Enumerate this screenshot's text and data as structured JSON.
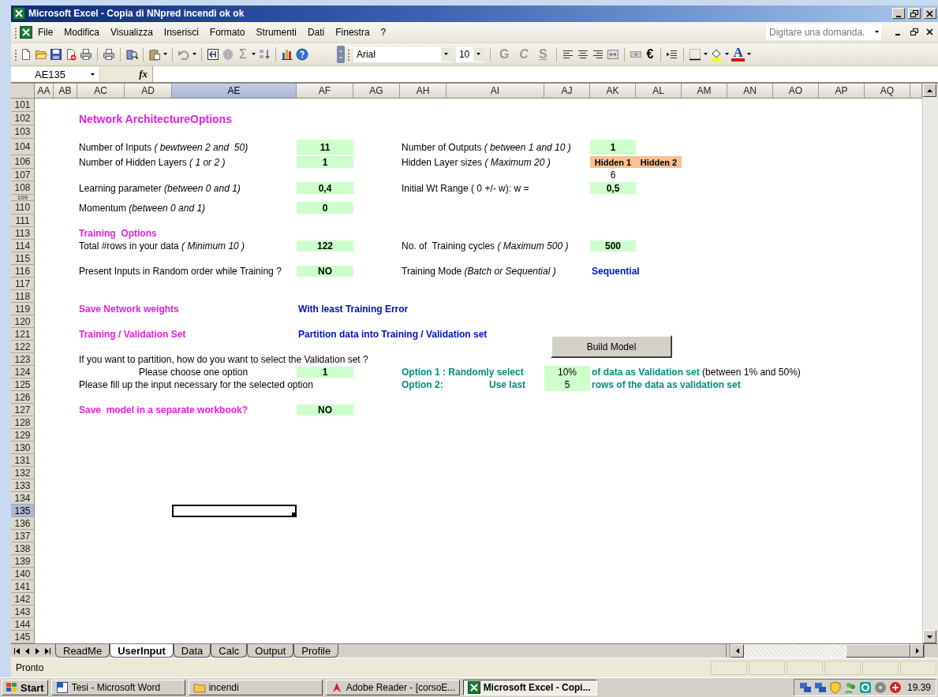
{
  "window": {
    "title": "Microsoft Excel - Copia di NNpred incendi ok ok"
  },
  "menu": {
    "items": [
      "File",
      "Modifica",
      "Visualizza",
      "Inserisci",
      "Formato",
      "Strumenti",
      "Dati",
      "Finestra",
      "?"
    ],
    "help_box": {
      "placeholder": "Digitare una domanda."
    }
  },
  "toolbar": {
    "sum": "Σ",
    "font": "Arial",
    "font_size": "10",
    "format_buttons": [
      "G",
      "C",
      "S"
    ],
    "currency": "€",
    "font_color": "A"
  },
  "formula_bar": {
    "name_box": "AE135",
    "fx": "fx"
  },
  "columns": [
    {
      "label": "AA",
      "selected": false
    },
    {
      "label": "AB",
      "selected": false
    },
    {
      "label": "AC",
      "selected": false
    },
    {
      "label": "AD",
      "selected": false
    },
    {
      "label": "AE",
      "selected": true
    },
    {
      "label": "AF",
      "selected": false
    },
    {
      "label": "AG",
      "selected": false
    },
    {
      "label": "AH",
      "selected": false
    },
    {
      "label": "AI",
      "selected": false
    },
    {
      "label": "AJ",
      "selected": false
    },
    {
      "label": "AK",
      "selected": false
    },
    {
      "label": "AL",
      "selected": false
    },
    {
      "label": "AM",
      "selected": false
    },
    {
      "label": "AN",
      "selected": false
    },
    {
      "label": "AO",
      "selected": false
    },
    {
      "label": "AP",
      "selected": false
    },
    {
      "label": "AQ",
      "selected": false
    }
  ],
  "rows": [
    {
      "label": "101",
      "kind": "tall",
      "selected": false
    },
    {
      "label": "102",
      "kind": "tall",
      "selected": false,
      "cells": {
        "ac": {
          "kind": "title",
          "text": "Network ArchitectureOptions"
        }
      }
    },
    {
      "label": "103",
      "kind": "tall",
      "selected": false
    },
    {
      "label": "104",
      "kind": "taller",
      "selected": false,
      "cells": {
        "ac": {
          "kind": "label",
          "text": "Number of Inputs *( bewtween 2 and  50)*"
        },
        "af": {
          "kind": "input",
          "text": "11"
        },
        "ah": {
          "kind": "label",
          "text": "Number of Outputs *( between 1 and 10 )*"
        },
        "ak": {
          "kind": "input",
          "text": "1"
        }
      }
    },
    {
      "label": "106",
      "kind": "tall",
      "selected": false,
      "cells": {
        "ac": {
          "kind": "label",
          "text": "Number of Hidden Layers *( 1 or 2 )*"
        },
        "af": {
          "kind": "input",
          "text": "1"
        },
        "ah": {
          "kind": "label",
          "text": "Hidden Layer sizes *( Maximum 20 )*"
        },
        "ak": {
          "kind": "layer-header",
          "text": "Hidden 1"
        },
        "al": {
          "kind": "layer-header",
          "text": "Hidden 2"
        }
      }
    },
    {
      "label": "107",
      "kind": "normal",
      "selected": false,
      "cells": {
        "ak": {
          "kind": "number",
          "text": "6"
        }
      }
    },
    {
      "label": "108",
      "kind": "tall",
      "selected": false,
      "cells": {
        "ac": {
          "kind": "label",
          "text": "Learning parameter *(between 0 and 1)*"
        },
        "af": {
          "kind": "input",
          "text": "0,4"
        },
        "ah": {
          "kind": "label",
          "text": "Initial Wt Range ( 0 +/- w): w ="
        },
        "ak": {
          "kind": "input",
          "text": "0,5"
        }
      }
    },
    {
      "label": "109",
      "kind": "short",
      "selected": false
    },
    {
      "label": "110",
      "kind": "tall",
      "selected": false,
      "cells": {
        "ac": {
          "kind": "label",
          "text": "Momentum *(between 0 and 1)*"
        },
        "af": {
          "kind": "input",
          "text": "0"
        }
      }
    },
    {
      "label": "111",
      "kind": "normal",
      "selected": false
    },
    {
      "label": "113",
      "kind": "normal",
      "selected": false,
      "cells": {
        "ac": {
          "kind": "heading",
          "text": "Training  Options"
        }
      }
    },
    {
      "label": "114",
      "kind": "normal",
      "selected": false,
      "cells": {
        "ac": {
          "kind": "label",
          "text": "Total #rows in your data *( Minimum 10 )*"
        },
        "af": {
          "kind": "input",
          "text": "122"
        },
        "ah": {
          "kind": "label",
          "text": "No. of  Training cycles *( Maximum 500 )*"
        },
        "ak": {
          "kind": "input",
          "text": "500"
        }
      }
    },
    {
      "label": "115",
      "kind": "normal",
      "selected": false
    },
    {
      "label": "116",
      "kind": "normal",
      "selected": false,
      "cells": {
        "ac": {
          "kind": "label",
          "text": "Present Inputs in Random order while Training ?"
        },
        "af": {
          "kind": "input",
          "text": "NO"
        },
        "ah": {
          "kind": "label",
          "text": "Training Mode *(Batch or Sequential )*"
        },
        "ak": {
          "kind": "value",
          "text": "Sequential"
        }
      }
    },
    {
      "label": "117",
      "kind": "normal",
      "selected": false
    },
    {
      "label": "118",
      "kind": "normal",
      "selected": false
    },
    {
      "label": "119",
      "kind": "normal",
      "selected": false,
      "cells": {
        "ac": {
          "kind": "heading",
          "text": "Save Network weights"
        },
        "af": {
          "kind": "value",
          "text": "With least Training Error"
        }
      }
    },
    {
      "label": "120",
      "kind": "normal",
      "selected": false
    },
    {
      "label": "121",
      "kind": "normal",
      "selected": false,
      "cells": {
        "ac": {
          "kind": "heading",
          "text": "Training / Validation Set"
        },
        "af": {
          "kind": "value",
          "text": "Partition data into Training / Validation set"
        }
      }
    },
    {
      "label": "122",
      "kind": "normal",
      "selected": false
    },
    {
      "label": "123",
      "kind": "normal",
      "selected": false,
      "cells": {
        "ac": {
          "kind": "label",
          "text": "If you want to partition, how do you want to select the Validation set ?"
        }
      }
    },
    {
      "label": "124",
      "kind": "normal",
      "selected": false,
      "cells": {
        "ad": {
          "kind": "indented",
          "text": "Please choose one option"
        },
        "af": {
          "kind": "input",
          "text": "1"
        },
        "ah": {
          "kind": "option",
          "text": "Option 1 : Randomly select"
        },
        "aj": {
          "kind": "input-plain",
          "text": "10%"
        },
        "ak": {
          "kind": "mixed",
          "text": "**of data as Validation set** (between 1% and 50%)"
        }
      }
    },
    {
      "label": "125",
      "kind": "normal",
      "selected": false,
      "cells": {
        "ac": {
          "kind": "label",
          "text": "Please fill up the input necessary for the selected option"
        },
        "ah": {
          "kind": "option",
          "text": "Option 2:"
        },
        "ai": {
          "kind": "option-right",
          "text": "Use last"
        },
        "aj": {
          "kind": "input-plain",
          "text": "5"
        },
        "ak": {
          "kind": "option",
          "text": "rows of the data as validation set"
        }
      }
    },
    {
      "label": "126",
      "kind": "normal",
      "selected": false
    },
    {
      "label": "127",
      "kind": "normal",
      "selected": false,
      "cells": {
        "ac": {
          "kind": "heading",
          "text": "Save  model in a separate workbook?"
        },
        "af": {
          "kind": "input",
          "text": "NO"
        }
      }
    },
    {
      "label": "128",
      "kind": "normal",
      "selected": false
    },
    {
      "label": "129",
      "kind": "normal",
      "selected": false
    },
    {
      "label": "130",
      "kind": "normal",
      "selected": false
    },
    {
      "label": "131",
      "kind": "normal",
      "selected": false
    },
    {
      "label": "132",
      "kind": "normal",
      "selected": false
    },
    {
      "label": "133",
      "kind": "normal",
      "selected": false
    },
    {
      "label": "134",
      "kind": "normal",
      "selected": false
    },
    {
      "label": "135",
      "kind": "normal",
      "selected": true,
      "cells": {
        "ae": {
          "kind": "cursor"
        }
      }
    },
    {
      "label": "136",
      "kind": "normal",
      "selected": false
    },
    {
      "label": "137",
      "kind": "normal",
      "selected": false
    },
    {
      "label": "138",
      "kind": "normal",
      "selected": false
    },
    {
      "label": "139",
      "kind": "normal",
      "selected": false
    },
    {
      "label": "140",
      "kind": "normal",
      "selected": false
    },
    {
      "label": "141",
      "kind": "normal",
      "selected": false
    },
    {
      "label": "142",
      "kind": "normal",
      "selected": false
    },
    {
      "label": "143",
      "kind": "normal",
      "selected": false
    },
    {
      "label": "144",
      "kind": "normal",
      "selected": false
    },
    {
      "label": "145",
      "kind": "normal",
      "selected": false
    }
  ],
  "buttons": [
    {
      "label": "Build Model"
    }
  ],
  "sheet_tabs": [
    {
      "label": "ReadMe",
      "selected": false
    },
    {
      "label": "UserInput",
      "selected": true
    },
    {
      "label": "Data",
      "selected": false
    },
    {
      "label": "Calc",
      "selected": false
    },
    {
      "label": "Output",
      "selected": false
    },
    {
      "label": "Profile",
      "selected": false
    }
  ],
  "status_bar": {
    "text": "Pronto"
  },
  "taskbar": {
    "start": "Start",
    "items": [
      {
        "label": "Tesi - Microsoft Word",
        "selected": false
      },
      {
        "label": "incendi",
        "selected": false
      },
      {
        "label": "Adobe Reader - [corsoE...",
        "selected": false
      },
      {
        "label": "Microsoft Excel - Copi...",
        "selected": true
      }
    ],
    "clock": "19.39"
  }
}
